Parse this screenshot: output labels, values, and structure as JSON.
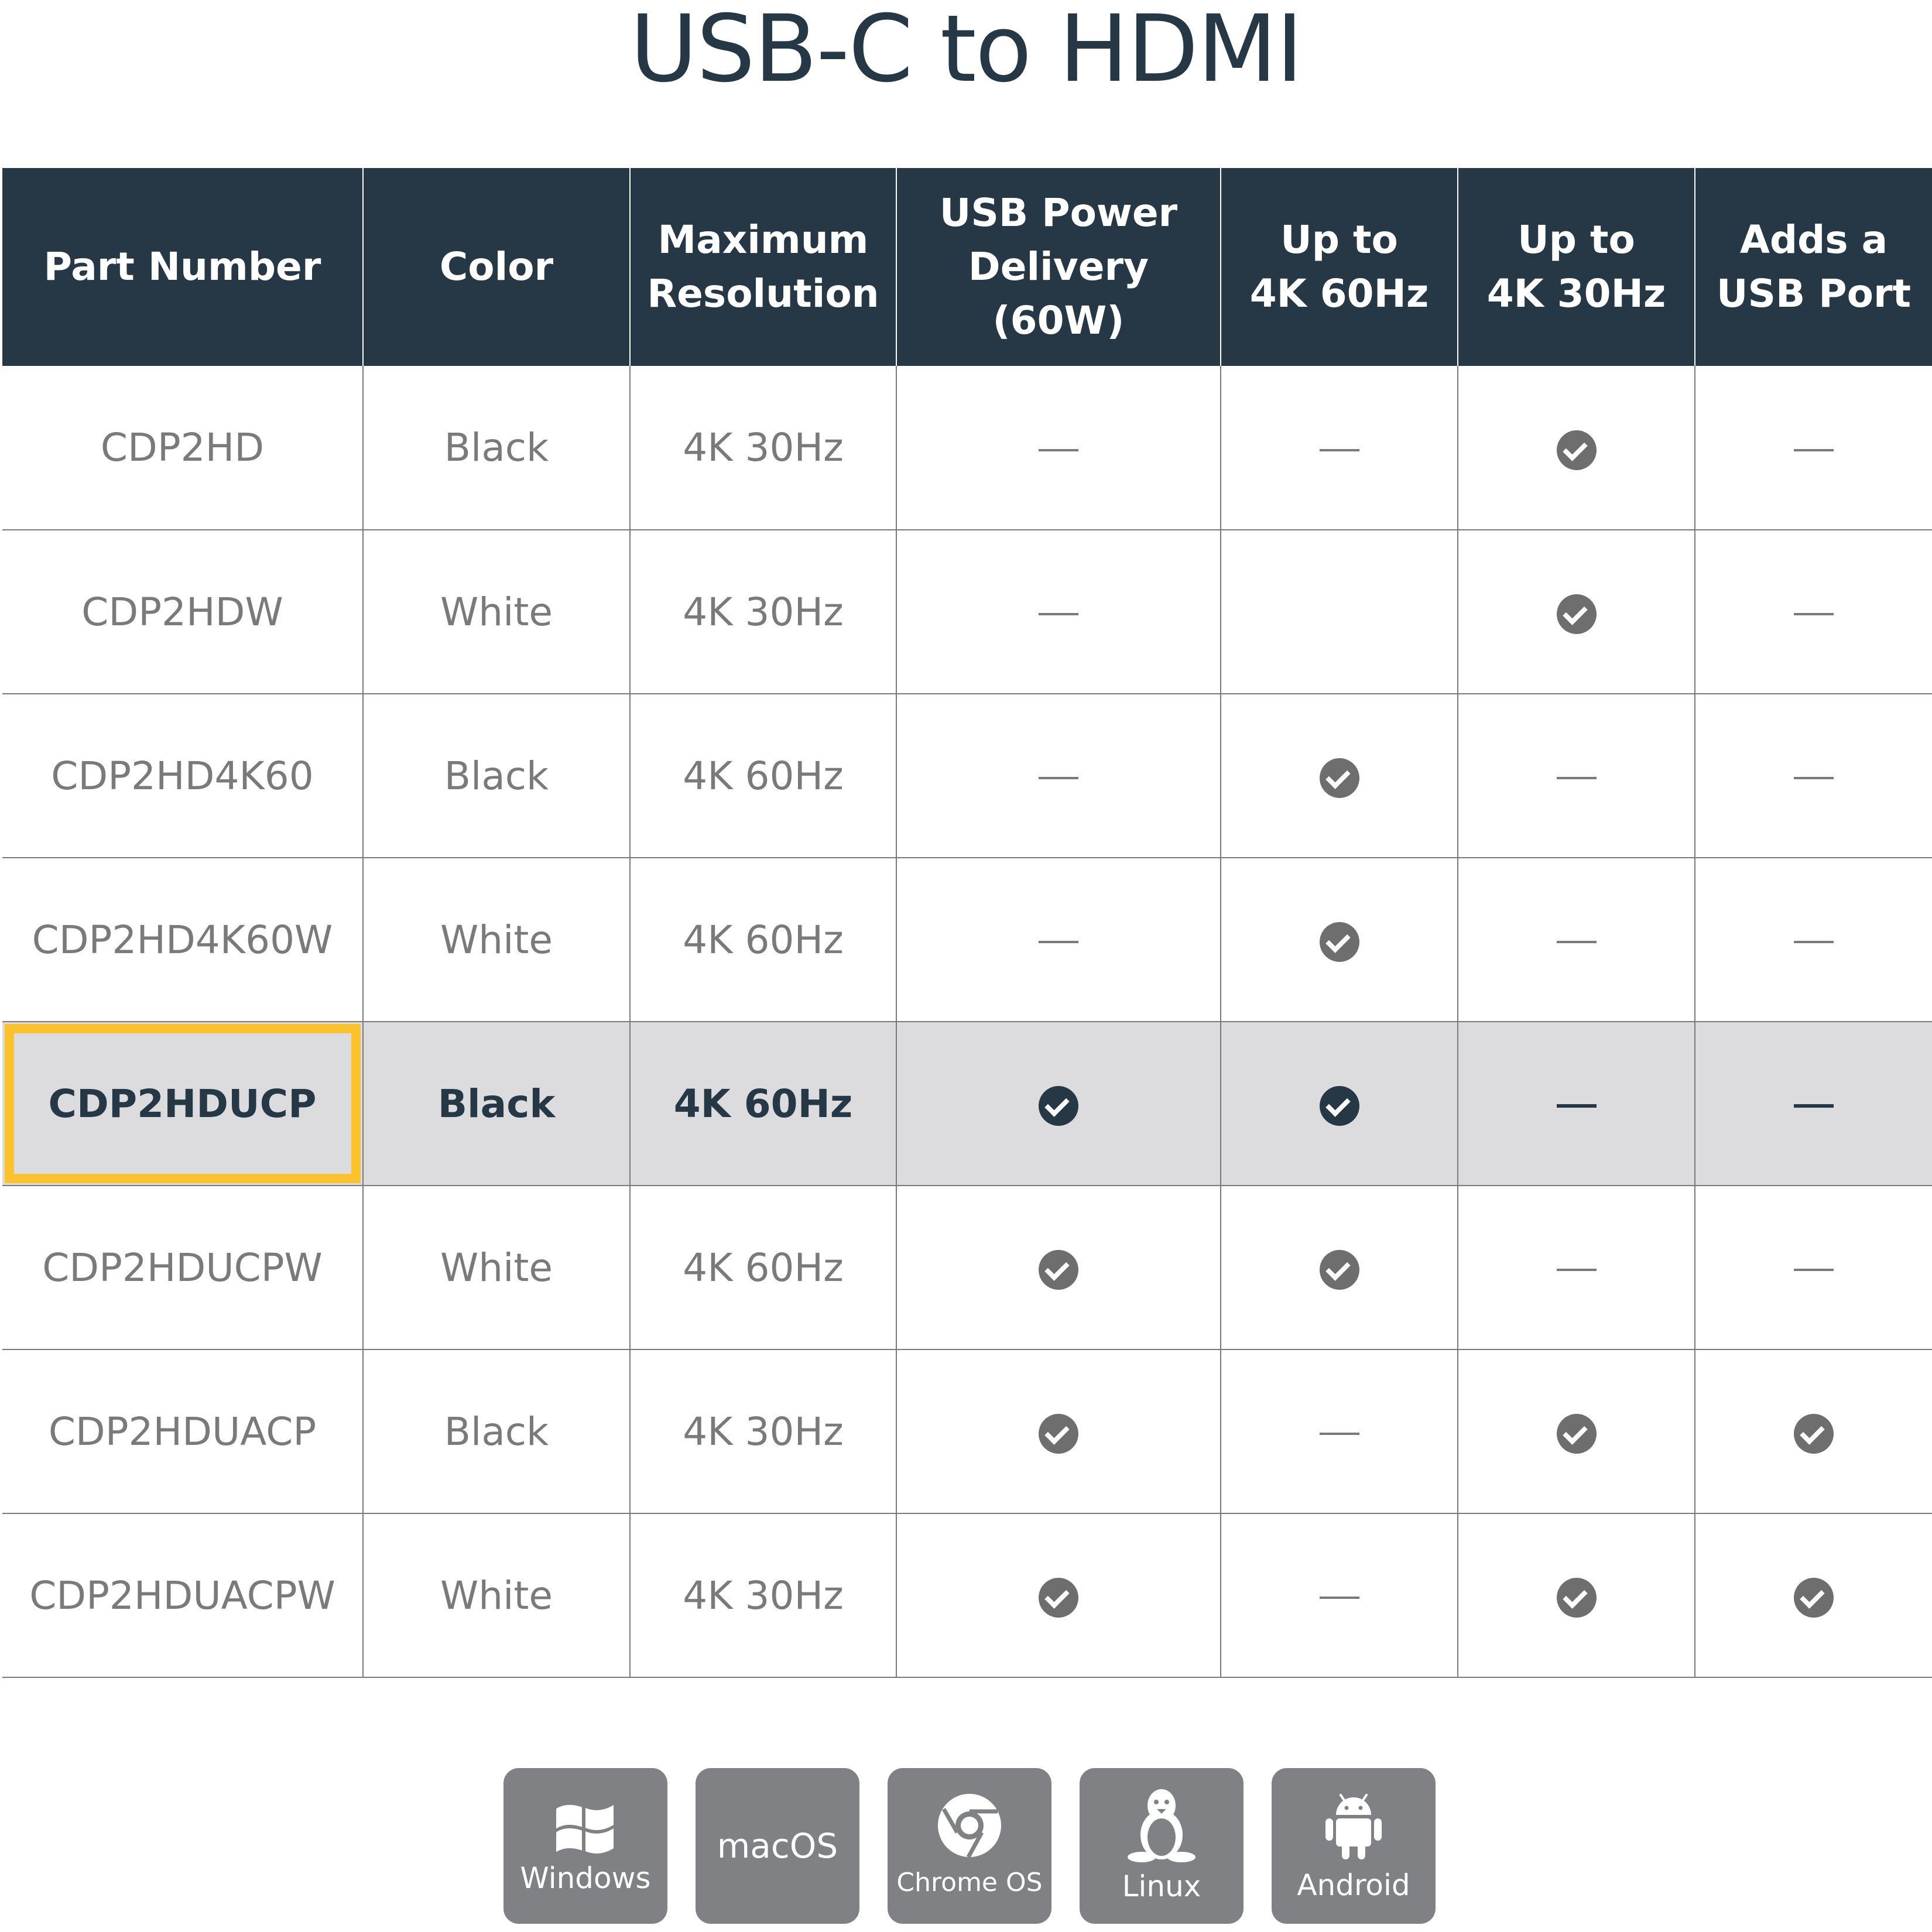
{
  "title": "USB-C to HDMI",
  "table": {
    "headers": [
      [
        "Part Number",
        ""
      ],
      [
        "Color",
        ""
      ],
      [
        "Maximum",
        "Resolution"
      ],
      [
        "USB Power",
        "Delivery (60W)"
      ],
      [
        "Up to",
        "4K 60Hz"
      ],
      [
        "Up to",
        "4K 30Hz"
      ],
      [
        "Adds a",
        "USB Port"
      ]
    ],
    "rows": [
      {
        "part": "CDP2HD",
        "color": "Black",
        "resolution": "4K 30Hz",
        "pd": "dash",
        "k60": "dash",
        "k30": "check",
        "usb": "dash",
        "highlight": false
      },
      {
        "part": "CDP2HDW",
        "color": "White",
        "resolution": "4K 30Hz",
        "pd": "dash",
        "k60": "none",
        "k30": "check",
        "usb": "dash",
        "highlight": false
      },
      {
        "part": "CDP2HD4K60",
        "color": "Black",
        "resolution": "4K 60Hz",
        "pd": "dash",
        "k60": "check",
        "k30": "dash",
        "usb": "dash",
        "highlight": false
      },
      {
        "part": "CDP2HD4K60W",
        "color": "White",
        "resolution": "4K 60Hz",
        "pd": "dash",
        "k60": "check",
        "k30": "dash",
        "usb": "dash",
        "highlight": false
      },
      {
        "part": "CDP2HDUCP",
        "color": "Black",
        "resolution": "4K 60Hz",
        "pd": "check",
        "k60": "check",
        "k30": "dash",
        "usb": "dash",
        "highlight": true
      },
      {
        "part": "CDP2HDUCPW",
        "color": "White",
        "resolution": "4K 60Hz",
        "pd": "check",
        "k60": "check",
        "k30": "dash",
        "usb": "dash",
        "highlight": false
      },
      {
        "part": "CDP2HDUACP",
        "color": "Black",
        "resolution": "4K 30Hz",
        "pd": "check",
        "k60": "dash",
        "k30": "check",
        "usb": "check",
        "highlight": false
      },
      {
        "part": "CDP2HDUACPW",
        "color": "White",
        "resolution": "4K 30Hz",
        "pd": "check",
        "k60": "dash",
        "k30": "check",
        "usb": "check",
        "highlight": false
      }
    ]
  },
  "os": [
    {
      "label": "Windows",
      "icon": "windows-icon"
    },
    {
      "label": "macOS",
      "icon": ""
    },
    {
      "label": "Chrome OS",
      "icon": "chrome-icon"
    },
    {
      "label": "Linux",
      "icon": "linux-icon"
    },
    {
      "label": "Android",
      "icon": "android-icon"
    }
  ],
  "colors": {
    "header_bg": "#263746",
    "highlight_bg": "#dcdcdf",
    "highlight_outline": "#fbc22d",
    "tile_bg": "#808184",
    "text_gray": "#7a7a7a"
  }
}
